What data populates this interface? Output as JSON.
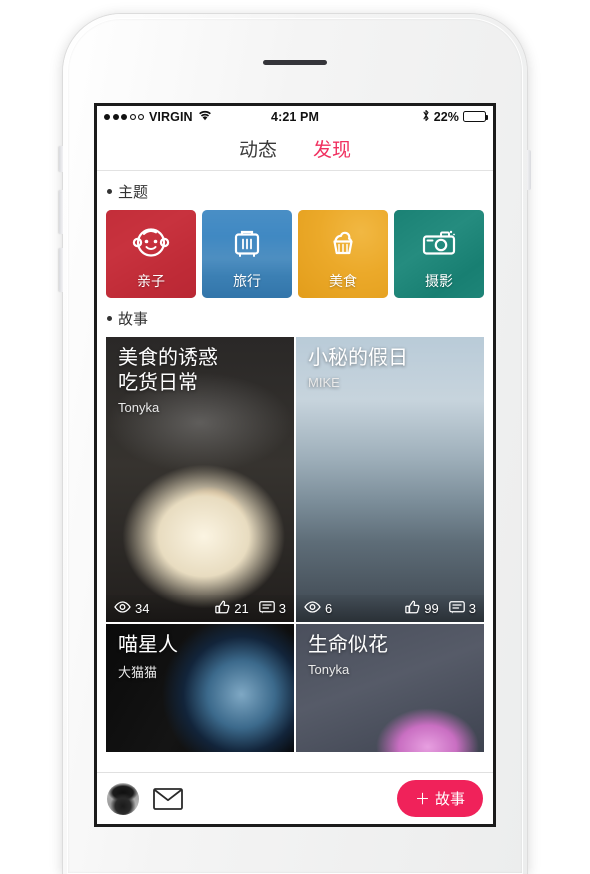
{
  "status_bar": {
    "signal_dots_filled": 3,
    "signal_dots_total": 5,
    "carrier": "VIRGIN",
    "wifi_icon": "wifi-icon",
    "time": "4:21 PM",
    "bluetooth_icon": "bluetooth-icon",
    "battery_percent_label": "22%",
    "battery_level": 22
  },
  "nav": {
    "tabs": [
      {
        "label": "动态",
        "active": false
      },
      {
        "label": "发现",
        "active": true
      }
    ],
    "active_color": "#f0305f",
    "inactive_color": "#3b3b3b"
  },
  "sections": {
    "themes_header": "主题",
    "stories_header": "故事"
  },
  "themes": [
    {
      "label": "亲子",
      "icon": "baby-face-icon",
      "color": "#cd2233"
    },
    {
      "label": "旅行",
      "icon": "suitcase-icon",
      "color": "#1c72b8"
    },
    {
      "label": "美食",
      "icon": "cupcake-icon",
      "color": "#e8a317"
    },
    {
      "label": "摄影",
      "icon": "camera-icon",
      "color": "#0f9080"
    }
  ],
  "stories": [
    {
      "title": "美食的诱惑\n吃货日常",
      "author": "Tonyka",
      "views": "34",
      "likes": "21",
      "comments": "3",
      "has_stats": true
    },
    {
      "title": "小秘的假日",
      "author": "MIKE",
      "views": "6",
      "likes": "99",
      "comments": "3",
      "has_stats": true
    },
    {
      "title": "喵星人",
      "author": "大猫猫",
      "has_stats": false
    },
    {
      "title": "生命似花",
      "author": "Tonyka",
      "has_stats": false
    }
  ],
  "toolbar": {
    "avatar": "user-avatar",
    "compose_icon": "envelope-icon",
    "add_story_label": "故事",
    "add_story_plus": "＋",
    "add_story_color": "#f0225a"
  }
}
